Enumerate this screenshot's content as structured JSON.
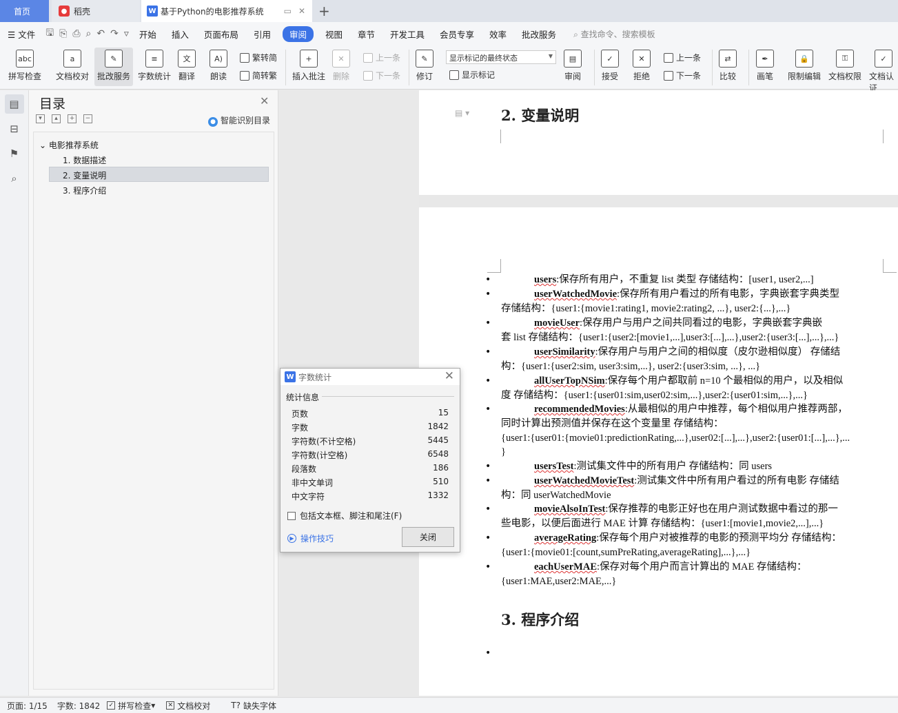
{
  "tabs": {
    "home": "首页",
    "docer": "稻壳",
    "doc": "基于Python的电影推荐系统",
    "doc_logo": "W"
  },
  "menu": {
    "file": "文件",
    "items": [
      "开始",
      "插入",
      "页面布局",
      "引用",
      "审阅",
      "视图",
      "章节",
      "开发工具",
      "会员专享",
      "效率",
      "批改服务"
    ],
    "active_index": 4,
    "search": "查找命令、搜索模板"
  },
  "ribbon": {
    "spell": "拼写检查",
    "proof": "文档校对",
    "correct": "批改服务",
    "wordcount": "字数统计",
    "translate": "翻译",
    "read": "朗读",
    "trad": "繁转简",
    "simp": "简转繁",
    "insert_comment": "插入批注",
    "delete": "删除",
    "prev": "上一条",
    "next": "下一条",
    "revise": "修订",
    "markup_state": "显示标记的最终状态",
    "show_markup": "显示标记",
    "review": "审阅",
    "accept": "接受",
    "reject": "拒绝",
    "prev2": "上一条",
    "next2": "下一条",
    "compare": "比较",
    "ink": "画笔",
    "restrict": "限制编辑",
    "rights": "文档权限",
    "cert": "文档认证"
  },
  "toc": {
    "title": "目录",
    "smart": "智能识别目录",
    "root": "电影推荐系统",
    "items": [
      "1. 数据描述",
      "2. 变量说明",
      "3. 程序介绍"
    ]
  },
  "doc": {
    "heading2": "2.  变量说明",
    "heading3": "3.  程序介绍",
    "bullets": [
      {
        "kw": "users",
        "lines": [
          ":保存所有用户，不重复 list 类型  存储结构：[user1, user2,...]"
        ]
      },
      {
        "kw": "userWatchedMovie",
        "lines": [
          ":保存所有用户看过的所有电影，字典嵌套字典类型",
          "存储结构：{user1:{movie1:rating1, movie2:rating2, ...}, user2:{...},...}"
        ]
      },
      {
        "kw": "movieUser",
        "lines": [
          ":保存用户与用户之间共同看过的电影，字典嵌套字典嵌",
          "套 list 存储结构：{user1:{user2:[movie1,...],user3:[...],...},user2:{user3:[...],...},...}"
        ]
      },
      {
        "kw": "userSimilarity",
        "lines": [
          ":保存用户与用户之间的相似度（皮尔逊相似度）  存储结",
          "构：{user1:{user2:sim, user3:sim,...}, user2:{user3:sim, ...}, ...}"
        ]
      },
      {
        "kw": "allUserTopNSim",
        "lines": [
          ":保存每个用户都取前 n=10 个最相似的用户，以及相似",
          "度  存储结构：{user1:{user01:sim,user02:sim,...},user2:{user01:sim,...},...}"
        ]
      },
      {
        "kw": "recommendedMovies",
        "lines": [
          ":从最相似的用户中推荐，每个相似用户推荐两部，",
          "同时计算出预测值并保存在这个变量里  存储结构：",
          "{user1:{user01:{movie01:predictionRating,...},user02:[...],...},user2:{user01:[...],...},...",
          "}"
        ]
      },
      {
        "kw": "usersTest",
        "lines": [
          ":测试集文件中的所有用户  存储结构：同 users"
        ]
      },
      {
        "kw": "userWatchedMovieTest",
        "lines": [
          ":测试集文件中所有用户看过的所有电影  存储结",
          "构：同 userWatchedMovie"
        ]
      },
      {
        "kw": "movieAlsoInTest",
        "lines": [
          ":保存推荐的电影正好也在用户测试数据中看过的那一",
          "些电影，以便后面进行  MAE  计算  存储结构：{user1:[movie1,movie2,...],...}"
        ]
      },
      {
        "kw": "averageRating",
        "lines": [
          ":保存每个用户对被推荐的电影的预测平均分  存储结构：",
          "{user1:{movie01:[count,sumPreRating,averageRating],...},...}"
        ]
      },
      {
        "kw": "eachUserMAE",
        "lines": [
          ":保存对每个用户而言计算出的 MAE 存储结构：",
          "{user1:MAE,user2:MAE,...}"
        ]
      }
    ]
  },
  "dialog": {
    "title": "字数统计",
    "section": "统计信息",
    "rows": [
      {
        "label": "页数",
        "value": "15"
      },
      {
        "label": "字数",
        "value": "1842"
      },
      {
        "label": "字符数(不计空格)",
        "value": "5445"
      },
      {
        "label": "字符数(计空格)",
        "value": "6548"
      },
      {
        "label": "段落数",
        "value": "186"
      },
      {
        "label": "非中文单词",
        "value": "510"
      },
      {
        "label": "中文字符",
        "value": "1332"
      }
    ],
    "checkbox": "包括文本框、脚注和尾注(F)",
    "tips": "操作技巧",
    "close": "关闭"
  },
  "status": {
    "page": "页面: 1/15",
    "words": "字数: 1842",
    "spell": "拼写检查",
    "proof": "文档校对",
    "missing_font": "缺失字体"
  }
}
